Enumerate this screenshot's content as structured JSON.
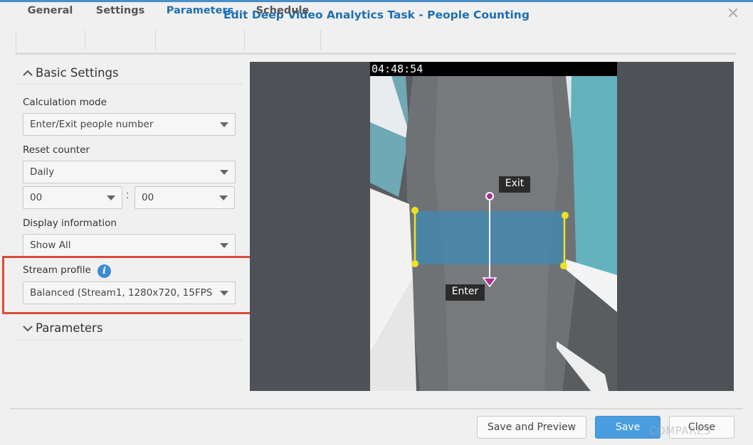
{
  "dialog": {
    "title": "Edit Deep Video Analytics Task - People Counting",
    "close_icon": "close-icon"
  },
  "tabs": [
    {
      "label": "General",
      "active": false
    },
    {
      "label": "Settings",
      "active": false
    },
    {
      "label": "Parameters",
      "active": true
    },
    {
      "label": "Schedule",
      "active": false
    }
  ],
  "basic_settings": {
    "header": "Basic Settings",
    "calculation_mode": {
      "label": "Calculation mode",
      "value": "Enter/Exit people number"
    },
    "reset_counter": {
      "label": "Reset counter",
      "value": "Daily",
      "hour": "00",
      "minute": "00"
    },
    "display_information": {
      "label": "Display information",
      "value": "Show All"
    },
    "stream_profile": {
      "label": "Stream profile",
      "value": "Balanced (Stream1, 1280x720, 15FPS",
      "info_icon": "info-icon"
    }
  },
  "parameters_section": {
    "header": "Parameters"
  },
  "preview": {
    "timestamp": "04:48:54",
    "exit_label": "Exit",
    "enter_label": "Enter"
  },
  "footer": {
    "save_preview_label": "Save and Preview",
    "save_label": "Save",
    "close_label": "Close",
    "watermark": "COMPARES"
  },
  "colors": {
    "accent": "#1e6fb3",
    "primary_button": "#4a9ee0",
    "highlight": "#d94b3b",
    "detection_zone": "#3a8ab8",
    "line_marker": "#f0e020"
  }
}
